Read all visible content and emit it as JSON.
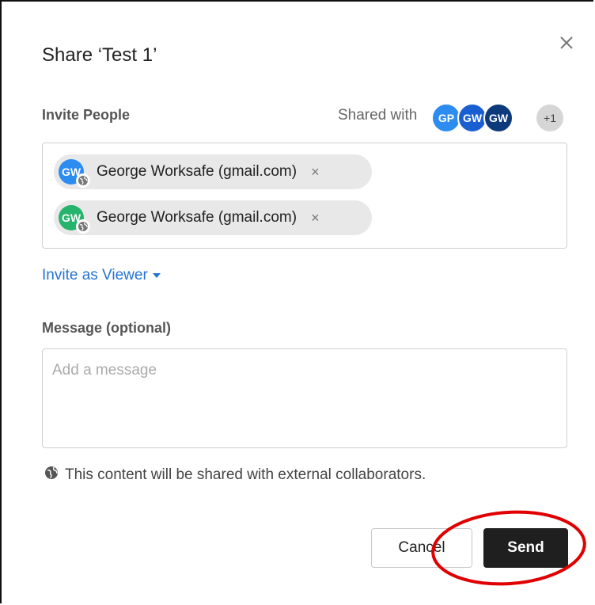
{
  "dialog": {
    "title": "Share ‘Test 1’",
    "close_icon": "close-icon"
  },
  "invite": {
    "label": "Invite People",
    "shared_with_label": "Shared with",
    "shared_avatars": [
      {
        "initials": "GP",
        "color": "#2d8cf0"
      },
      {
        "initials": "GW",
        "color": "#1a5fd1"
      },
      {
        "initials": "GW",
        "color": "#0d3a7a"
      }
    ],
    "more_count": "+1",
    "more_color": "#d6d6d6",
    "recipients": [
      {
        "initials": "GW",
        "name": "George Worksafe (gmail.com)",
        "color": "#2d8cf0",
        "remove": "×"
      },
      {
        "initials": "GW",
        "name": "George Worksafe (gmail.com)",
        "color": "#26b36b",
        "remove": "×"
      }
    ],
    "role_link": "Invite as Viewer"
  },
  "message": {
    "label": "Message (optional)",
    "placeholder": "Add a message",
    "value": ""
  },
  "notice": {
    "text": "This content will be shared with external collaborators.",
    "icon": "globe-icon"
  },
  "actions": {
    "cancel_label": "Cancel",
    "send_label": "Send"
  },
  "colors": {
    "link": "#2574cf",
    "send_bg": "#1f1f1f",
    "annotation_red": "#e00000"
  }
}
